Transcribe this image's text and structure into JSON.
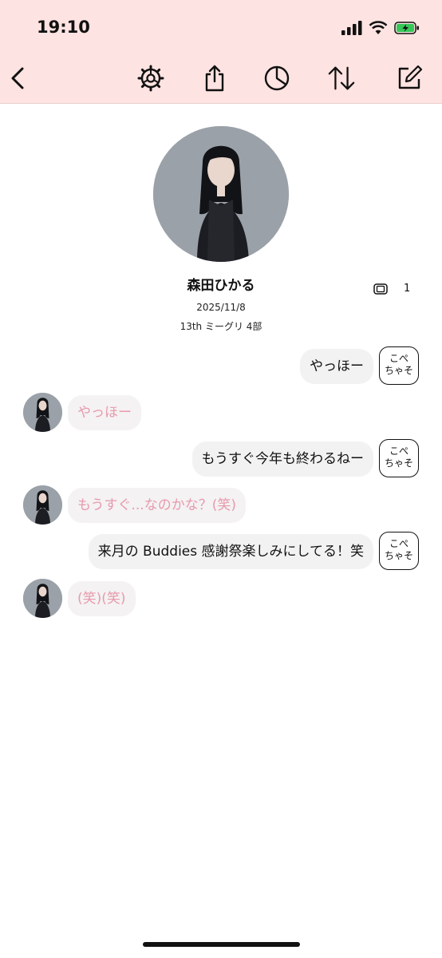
{
  "status_bar": {
    "time": "19:10"
  },
  "toolbar": {
    "back_icon": "chevron-left-icon",
    "settings_icon": "gear-icon",
    "share_icon": "share-icon",
    "chart_icon": "pie-chart-icon",
    "sort_icon": "sort-arrows-icon",
    "compose_icon": "compose-icon"
  },
  "profile": {
    "name": "森田ひかる",
    "date": "2025/11/8",
    "event": "13th ミーグリ 4部",
    "count": "1"
  },
  "messages": [
    {
      "side": "out",
      "text": "やっほー",
      "stamp": "こぺ\nちゃそ"
    },
    {
      "side": "in",
      "text": "やっほー"
    },
    {
      "side": "out",
      "text": "もうすぐ今年も終わるねー",
      "stamp": "こぺ\nちゃそ"
    },
    {
      "side": "in",
      "text": "もうすぐ...なのかな？(笑)"
    },
    {
      "side": "out",
      "text": "来月の Buddies 感謝祭楽しみにしてる！笑",
      "stamp": "こぺ\nちゃそ"
    },
    {
      "side": "in",
      "text": "(笑)(笑)"
    }
  ],
  "colors": {
    "header_bg": "#fde3e1",
    "incoming_text": "#e79aae",
    "bubble_bg": "#f2f2f2"
  }
}
